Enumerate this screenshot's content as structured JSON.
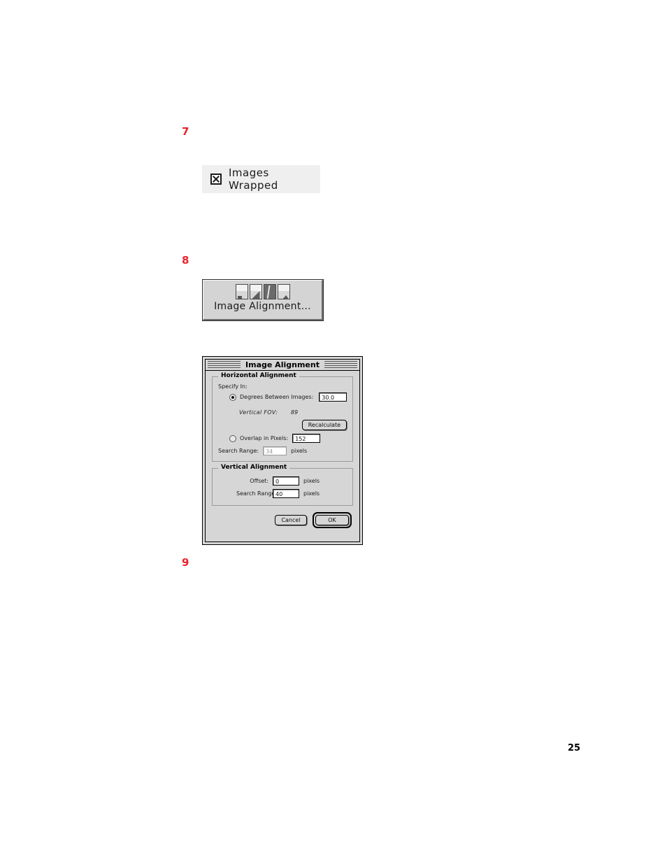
{
  "page": {
    "page_number": "25",
    "accent_color": "#e8232a"
  },
  "steps": [
    {
      "number": "7"
    },
    {
      "number": "8"
    },
    {
      "number": "9"
    }
  ],
  "figure_wrapped": {
    "checkbox_state": "checked",
    "checkbox_glyph": "x-mark-icon",
    "label": "Images Wrapped"
  },
  "figure_align_button": {
    "label": "Image Alignment...",
    "thumbnails": [
      {
        "name": "panorama-thumb-1"
      },
      {
        "name": "panorama-thumb-2"
      },
      {
        "name": "panorama-thumb-3"
      },
      {
        "name": "panorama-thumb-4"
      }
    ]
  },
  "dialog": {
    "title": "Image Alignment",
    "horizontal_group": {
      "legend": "Horizontal Alignment",
      "specify_in_label": "Specify In:",
      "degrees_option": {
        "label": "Degrees Between Images:",
        "selected": true,
        "value": "30.0"
      },
      "fov": {
        "label": "Vertical FOV:",
        "value": "89"
      },
      "recalculate_button": "Recalculate",
      "overlap_option": {
        "label": "Overlap in Pixels:",
        "selected": false,
        "value": "152"
      },
      "search_range": {
        "label": "Search Range:",
        "value": "34",
        "units": "pixels",
        "disabled": true
      }
    },
    "vertical_group": {
      "legend": "Vertical Alignment",
      "offset": {
        "label": "Offset:",
        "value": "0",
        "units": "pixels"
      },
      "search_range": {
        "label": "Search Range:",
        "value": "40",
        "units": "pixels"
      }
    },
    "buttons": {
      "cancel": "Cancel",
      "ok": "OK"
    }
  }
}
